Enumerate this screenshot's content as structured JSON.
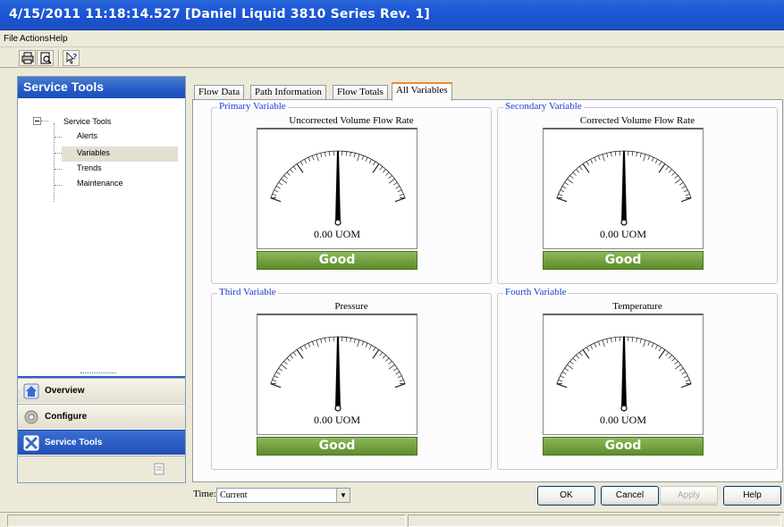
{
  "window": {
    "title": "4/15/2011 11:18:14.527 [Daniel Liquid 3810 Series Rev. 1]"
  },
  "menu": {
    "items": [
      "File",
      "Actions",
      "Help"
    ]
  },
  "toolbar": {
    "icons": [
      "print-icon",
      "print-preview-icon",
      "context-help-icon"
    ]
  },
  "nav": {
    "header": "Service Tools",
    "tree_root": "Service Tools",
    "tree_children": [
      "Alerts",
      "Variables",
      "Trends",
      "Maintenance"
    ],
    "selected": "Variables",
    "buttons": [
      "Overview",
      "Configure",
      "Service Tools"
    ],
    "active_button": "Service Tools"
  },
  "tabs": {
    "items": [
      "Flow Data",
      "Path Information",
      "Flow Totals",
      "All Variables"
    ],
    "active": "All Variables"
  },
  "variables": [
    {
      "group": "Primary Variable",
      "title": "Uncorrected Volume Flow Rate",
      "reading": "0.00 UOM",
      "status": "Good"
    },
    {
      "group": "Secondary Variable",
      "title": "Corrected Volume Flow Rate",
      "reading": "0.00 UOM",
      "status": "Good"
    },
    {
      "group": "Third Variable",
      "title": "Pressure",
      "reading": "0.00 UOM",
      "status": "Good"
    },
    {
      "group": "Fourth Variable",
      "title": "Temperature",
      "reading": "0.00 UOM",
      "status": "Good"
    }
  ],
  "time": {
    "label": "Time:",
    "value": "Current"
  },
  "buttons": {
    "ok": "OK",
    "cancel": "Cancel",
    "apply": "Apply",
    "help": "Help"
  },
  "colors": {
    "title_bar": "#245edb",
    "status_good": "#6e9b38",
    "group_label": "#1a3fd0",
    "active_tab_accent": "#e68b2c"
  }
}
